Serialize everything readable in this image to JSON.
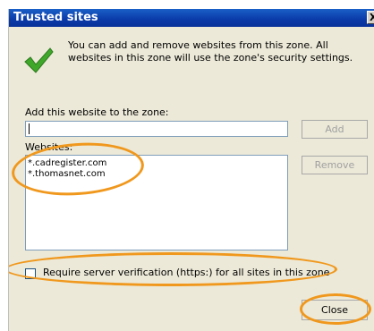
{
  "window": {
    "title": "Trusted sites",
    "close_glyph": "X"
  },
  "info": {
    "icon": "checkmark-icon",
    "text": "You can add and remove websites from this zone. All websites in this zone will use the zone's security settings."
  },
  "add_section": {
    "label": "Add this website to the zone:",
    "input_value": "",
    "add_button": "Add"
  },
  "websites": {
    "label": "Websites:",
    "items": [
      "*.cadregister.com",
      "*.thomasnet.com"
    ],
    "remove_button": "Remove"
  },
  "require_https": {
    "label": "Require server verification (https:) for all sites in this zone",
    "checked": false
  },
  "close_button": "Close",
  "colors": {
    "titlebar": "#0a3aa8",
    "annotation": "#f0981d",
    "checkmark": "#3fa82a"
  }
}
